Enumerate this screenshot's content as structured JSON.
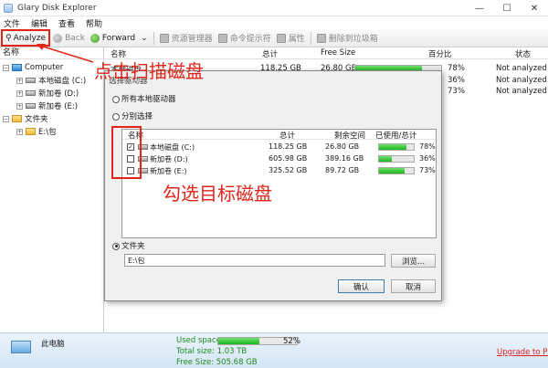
{
  "window": {
    "title": "Glary Disk Explorer",
    "minimize": "—",
    "maximize": "☐",
    "close": "✕"
  },
  "menu": [
    "文件",
    "编辑",
    "查看",
    "帮助"
  ],
  "toolbar": {
    "analyze": "Analyze",
    "back": "Back",
    "forward": "Forward",
    "forward_dropdown": "⌄",
    "explorer": "资源管理器",
    "cmd": "命令提示符",
    "properties": "属性",
    "recycle": "删除到垃圾箱"
  },
  "left_panel": {
    "header": "名称",
    "computer": "Computer",
    "drives": [
      "本地磁盘 (C:)",
      "新加卷 (D:)",
      "新加卷 (E:)"
    ],
    "folders": "文件夹",
    "folder_item": "E:\\包"
  },
  "list": {
    "headers": {
      "name": "名称",
      "total": "总计",
      "free": "Free Size",
      "percent": "百分比",
      "status": "状态"
    },
    "rows": [
      {
        "name": "本地磁盘",
        "total": "118.25 GB",
        "free": "26.80 GB",
        "used_fraction": 0.78,
        "percent": "78%",
        "status": "Not analyzed"
      },
      {
        "name": "",
        "total": "",
        "free": "",
        "used_fraction": 0.36,
        "percent": "36%",
        "status": "Not analyzed"
      },
      {
        "name": "",
        "total": "",
        "free": "",
        "used_fraction": 0.73,
        "percent": "73%",
        "status": "Not analyzed"
      }
    ]
  },
  "dialog": {
    "group_label": "选择驱动器",
    "option_all": "所有本地驱动器",
    "option_separate": "分别选择",
    "headers": {
      "name": "名称",
      "total": "总计",
      "free": "剩余空间",
      "used": "已使用/总计"
    },
    "rows": [
      {
        "checked": true,
        "name": "本地磁盘 (C:)",
        "total": "118.25 GB",
        "free": "26.80 GB",
        "used_fraction": 0.78,
        "percent": "78%"
      },
      {
        "checked": false,
        "name": "新加卷 (D:)",
        "total": "605.98 GB",
        "free": "389.16 GB",
        "used_fraction": 0.36,
        "percent": "36%"
      },
      {
        "checked": false,
        "name": "新加卷 (E:)",
        "total": "325.52 GB",
        "free": "89.72 GB",
        "used_fraction": 0.73,
        "percent": "73%"
      }
    ],
    "option_folder": "文件夹",
    "folder_path": "E:\\包",
    "browse": "浏览...",
    "ok": "确认",
    "cancel": "取消"
  },
  "annotations": {
    "click_scan": "点击扫描磁盘",
    "check_target": "勾选目标磁盘"
  },
  "statusbar": {
    "pc_label": "此电脑",
    "used_label": "Used space:",
    "used_fraction": 0.52,
    "used_percent": "52%",
    "total_label": "Total size: 1.03 TB",
    "free_label": "Free Size: 505.68 GB",
    "upgrade": "Upgrade to Pro"
  },
  "colors": {
    "accent_red": "#e0261b",
    "bar_green": "#1fb51f",
    "status_green": "#1d8a1d"
  }
}
